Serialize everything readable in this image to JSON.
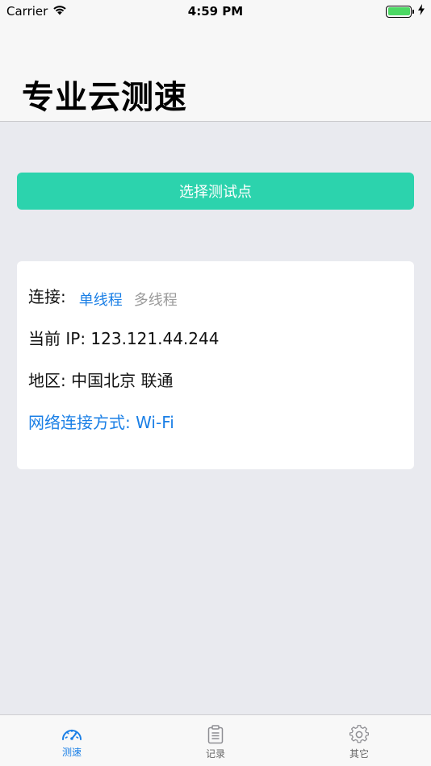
{
  "status_bar": {
    "carrier": "Carrier",
    "time": "4:59 PM"
  },
  "header": {
    "title": "专业云测速"
  },
  "select_button": {
    "label": "选择测试点"
  },
  "info": {
    "connection_label": "连接:",
    "single_thread": "单线程",
    "multi_thread": "多线程",
    "ip": "当前 IP: 123.121.44.244",
    "region": "地区: 中国北京  联通",
    "network": "网络连接方式: Wi-Fi"
  },
  "tabs": [
    {
      "label": "测速",
      "icon": "speedometer-icon",
      "active": true
    },
    {
      "label": "记录",
      "icon": "clipboard-icon",
      "active": false
    },
    {
      "label": "其它",
      "icon": "gear-icon",
      "active": false
    }
  ],
  "colors": {
    "accent": "#2cd3ad",
    "link": "#1a7fe6",
    "background": "#e9eaef"
  }
}
